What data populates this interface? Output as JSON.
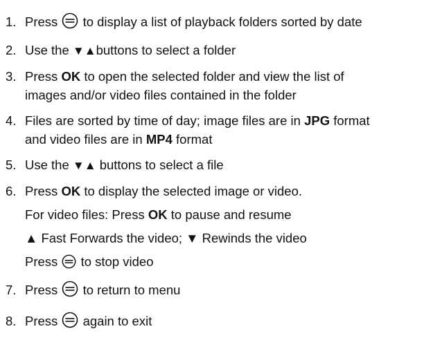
{
  "steps": [
    {
      "number": "1.",
      "text_before_icon": "Press ",
      "icon": "menu-icon",
      "text_after_icon": " to display a list of playback folders sorted by date"
    },
    {
      "number": "2.",
      "text_before": "Use the ",
      "arrows": "▼▲",
      "text_after": "buttons to select a folder"
    },
    {
      "number": "3.",
      "text_before_bold": "Press ",
      "bold": "OK",
      "text_after_bold": " to open  the selected folder and view the list of",
      "line2": "images and/or video files contained in the folder"
    },
    {
      "number": "4.",
      "line1_before_bold": "Files are sorted by time of day; image files are in ",
      "line1_bold": "JPG",
      "line1_after_bold": " format",
      "line2_before_bold": "and video files are in ",
      "line2_bold": "MP4",
      "line2_after_bold": " format"
    },
    {
      "number": "5.",
      "text_before": "Use the ",
      "arrows": "▼▲",
      "text_after": "buttons to select a file"
    },
    {
      "number": "6.",
      "text_before_bold": "Press ",
      "bold": "OK",
      "text_after_bold": " to display the selected image or video.",
      "sub1_before_bold": "For video files: Press ",
      "sub1_bold": "OK",
      "sub1_after_bold": " to pause and resume",
      "sub2": "▲ Fast Forwards the video; ▼ Rewinds the video",
      "sub3_before_icon": "Press ",
      "sub3_icon": "menu-icon",
      "sub3_after_icon": " to stop video"
    },
    {
      "number": "7.",
      "text_before_icon": "Press ",
      "icon": "menu-icon",
      "text_after_icon": " to return to menu"
    },
    {
      "number": "8.",
      "text_before_icon": "Press ",
      "icon": "menu-icon",
      "text_after_icon": " again to exit"
    }
  ]
}
